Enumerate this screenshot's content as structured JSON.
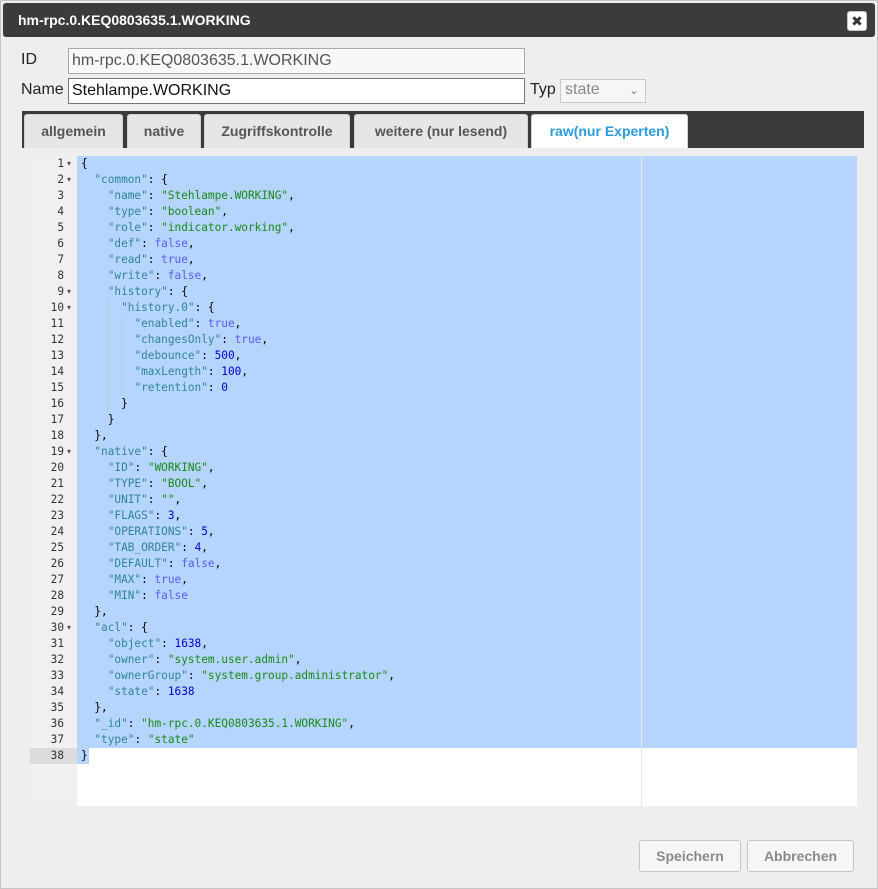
{
  "dialog": {
    "title": "hm-rpc.0.KEQ0803635.1.WORKING",
    "close_glyph": "✖"
  },
  "form": {
    "id_label": "ID",
    "id_value": "hm-rpc.0.KEQ0803635.1.WORKING",
    "name_label": "Name",
    "name_value": "Stehlampe.WORKING",
    "type_label": "Typ",
    "type_value": "state"
  },
  "tabs": [
    {
      "label": "allgemein",
      "active": false
    },
    {
      "label": "native",
      "active": false
    },
    {
      "label": "Zugriffskontrolle",
      "active": false
    },
    {
      "label": "weitere (nur lesend)",
      "active": false
    },
    {
      "label": "raw(nur Experten)",
      "active": true
    }
  ],
  "editor": {
    "lines": [
      [
        [
          "{",
          "p"
        ]
      ],
      [
        [
          "  ",
          "p"
        ],
        [
          "\"common\"",
          "k"
        ],
        [
          ": {",
          "p"
        ]
      ],
      [
        [
          "    ",
          "p"
        ],
        [
          "\"name\"",
          "k"
        ],
        [
          ": ",
          "p"
        ],
        [
          "\"Stehlampe.WORKING\"",
          "s"
        ],
        [
          ",",
          "p"
        ]
      ],
      [
        [
          "    ",
          "p"
        ],
        [
          "\"type\"",
          "k"
        ],
        [
          ": ",
          "p"
        ],
        [
          "\"boolean\"",
          "s"
        ],
        [
          ",",
          "p"
        ]
      ],
      [
        [
          "    ",
          "p"
        ],
        [
          "\"role\"",
          "k"
        ],
        [
          ": ",
          "p"
        ],
        [
          "\"indicator.working\"",
          "s"
        ],
        [
          ",",
          "p"
        ]
      ],
      [
        [
          "    ",
          "p"
        ],
        [
          "\"def\"",
          "k"
        ],
        [
          ": ",
          "p"
        ],
        [
          "false",
          "b"
        ],
        [
          ",",
          "p"
        ]
      ],
      [
        [
          "    ",
          "p"
        ],
        [
          "\"read\"",
          "k"
        ],
        [
          ": ",
          "p"
        ],
        [
          "true",
          "b"
        ],
        [
          ",",
          "p"
        ]
      ],
      [
        [
          "    ",
          "p"
        ],
        [
          "\"write\"",
          "k"
        ],
        [
          ": ",
          "p"
        ],
        [
          "false",
          "b"
        ],
        [
          ",",
          "p"
        ]
      ],
      [
        [
          "    ",
          "p"
        ],
        [
          "\"history\"",
          "k"
        ],
        [
          ": {",
          "p"
        ]
      ],
      [
        [
          "      ",
          "p"
        ],
        [
          "\"history.0\"",
          "k"
        ],
        [
          ": {",
          "p"
        ]
      ],
      [
        [
          "        ",
          "p"
        ],
        [
          "\"enabled\"",
          "k"
        ],
        [
          ": ",
          "p"
        ],
        [
          "true",
          "b"
        ],
        [
          ",",
          "p"
        ]
      ],
      [
        [
          "        ",
          "p"
        ],
        [
          "\"changesOnly\"",
          "k"
        ],
        [
          ": ",
          "p"
        ],
        [
          "true",
          "b"
        ],
        [
          ",",
          "p"
        ]
      ],
      [
        [
          "        ",
          "p"
        ],
        [
          "\"debounce\"",
          "k"
        ],
        [
          ": ",
          "p"
        ],
        [
          "500",
          "n"
        ],
        [
          ",",
          "p"
        ]
      ],
      [
        [
          "        ",
          "p"
        ],
        [
          "\"maxLength\"",
          "k"
        ],
        [
          ": ",
          "p"
        ],
        [
          "100",
          "n"
        ],
        [
          ",",
          "p"
        ]
      ],
      [
        [
          "        ",
          "p"
        ],
        [
          "\"retention\"",
          "k"
        ],
        [
          ": ",
          "p"
        ],
        [
          "0",
          "n"
        ]
      ],
      [
        [
          "      }",
          "p"
        ]
      ],
      [
        [
          "    }",
          "p"
        ]
      ],
      [
        [
          "  },",
          "p"
        ]
      ],
      [
        [
          "  ",
          "p"
        ],
        [
          "\"native\"",
          "k"
        ],
        [
          ": {",
          "p"
        ]
      ],
      [
        [
          "    ",
          "p"
        ],
        [
          "\"ID\"",
          "k"
        ],
        [
          ": ",
          "p"
        ],
        [
          "\"WORKING\"",
          "s"
        ],
        [
          ",",
          "p"
        ]
      ],
      [
        [
          "    ",
          "p"
        ],
        [
          "\"TYPE\"",
          "k"
        ],
        [
          ": ",
          "p"
        ],
        [
          "\"BOOL\"",
          "s"
        ],
        [
          ",",
          "p"
        ]
      ],
      [
        [
          "    ",
          "p"
        ],
        [
          "\"UNIT\"",
          "k"
        ],
        [
          ": ",
          "p"
        ],
        [
          "\"\"",
          "s"
        ],
        [
          ",",
          "p"
        ]
      ],
      [
        [
          "    ",
          "p"
        ],
        [
          "\"FLAGS\"",
          "k"
        ],
        [
          ": ",
          "p"
        ],
        [
          "3",
          "n"
        ],
        [
          ",",
          "p"
        ]
      ],
      [
        [
          "    ",
          "p"
        ],
        [
          "\"OPERATIONS\"",
          "k"
        ],
        [
          ": ",
          "p"
        ],
        [
          "5",
          "n"
        ],
        [
          ",",
          "p"
        ]
      ],
      [
        [
          "    ",
          "p"
        ],
        [
          "\"TAB_ORDER\"",
          "k"
        ],
        [
          ": ",
          "p"
        ],
        [
          "4",
          "n"
        ],
        [
          ",",
          "p"
        ]
      ],
      [
        [
          "    ",
          "p"
        ],
        [
          "\"DEFAULT\"",
          "k"
        ],
        [
          ": ",
          "p"
        ],
        [
          "false",
          "b"
        ],
        [
          ",",
          "p"
        ]
      ],
      [
        [
          "    ",
          "p"
        ],
        [
          "\"MAX\"",
          "k"
        ],
        [
          ": ",
          "p"
        ],
        [
          "true",
          "b"
        ],
        [
          ",",
          "p"
        ]
      ],
      [
        [
          "    ",
          "p"
        ],
        [
          "\"MIN\"",
          "k"
        ],
        [
          ": ",
          "p"
        ],
        [
          "false",
          "b"
        ]
      ],
      [
        [
          "  },",
          "p"
        ]
      ],
      [
        [
          "  ",
          "p"
        ],
        [
          "\"acl\"",
          "k"
        ],
        [
          ": {",
          "p"
        ]
      ],
      [
        [
          "    ",
          "p"
        ],
        [
          "\"object\"",
          "k"
        ],
        [
          ": ",
          "p"
        ],
        [
          "1638",
          "n"
        ],
        [
          ",",
          "p"
        ]
      ],
      [
        [
          "    ",
          "p"
        ],
        [
          "\"owner\"",
          "k"
        ],
        [
          ": ",
          "p"
        ],
        [
          "\"system.user.admin\"",
          "s"
        ],
        [
          ",",
          "p"
        ]
      ],
      [
        [
          "    ",
          "p"
        ],
        [
          "\"ownerGroup\"",
          "k"
        ],
        [
          ": ",
          "p"
        ],
        [
          "\"system.group.administrator\"",
          "s"
        ],
        [
          ",",
          "p"
        ]
      ],
      [
        [
          "    ",
          "p"
        ],
        [
          "\"state\"",
          "k"
        ],
        [
          ": ",
          "p"
        ],
        [
          "1638",
          "n"
        ]
      ],
      [
        [
          "  },",
          "p"
        ]
      ],
      [
        [
          "  ",
          "p"
        ],
        [
          "\"_id\"",
          "k"
        ],
        [
          ": ",
          "p"
        ],
        [
          "\"hm-rpc.0.KEQ0803635.1.WORKING\"",
          "s"
        ],
        [
          ",",
          "p"
        ]
      ],
      [
        [
          "  ",
          "p"
        ],
        [
          "\"type\"",
          "k"
        ],
        [
          ": ",
          "p"
        ],
        [
          "\"state\"",
          "s"
        ]
      ],
      [
        [
          "}",
          "p"
        ]
      ]
    ],
    "fold_markers": [
      1,
      2,
      9,
      10,
      19,
      30
    ],
    "fold_glyph": "▾"
  },
  "buttons": {
    "save": "Speichern",
    "cancel": "Abbrechen"
  }
}
